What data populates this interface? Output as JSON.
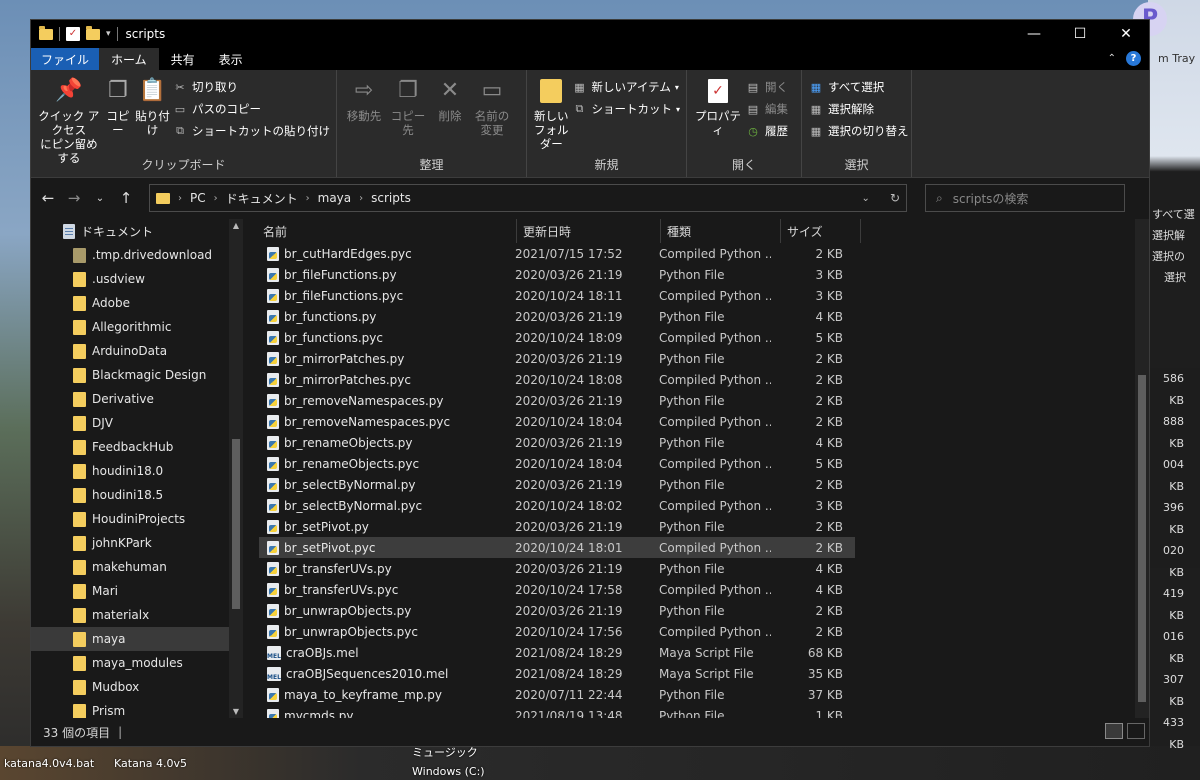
{
  "window": {
    "title": "scripts",
    "controls": [
      "minimize-icon",
      "maximize-icon",
      "close-icon"
    ]
  },
  "ribbon_tabs": [
    "ファイル",
    "ホーム",
    "共有",
    "表示"
  ],
  "ribbon": {
    "clipboard": {
      "label": "クリップボード",
      "pin": "クイック アクセス\nにピン留めする",
      "copy": "コピー",
      "paste": "貼り付け",
      "cut": "切り取り",
      "copy_path": "パスのコピー",
      "paste_shortcut": "ショートカットの貼り付け"
    },
    "organize": {
      "label": "整理",
      "move_to": "移動先",
      "copy_to": "コピー先",
      "delete": "削除",
      "rename": "名前の\n変更"
    },
    "new": {
      "label": "新規",
      "new_folder": "新しい\nフォルダー",
      "new_item": "新しいアイテム",
      "shortcut": "ショートカット"
    },
    "open": {
      "label": "開く",
      "properties": "プロパティ",
      "open": "開く",
      "edit": "編集",
      "history": "履歴"
    },
    "select": {
      "label": "選択",
      "select_all": "すべて選択",
      "select_none": "選択解除",
      "invert": "選択の切り替え"
    }
  },
  "address": {
    "crumbs": [
      "PC",
      "ドキュメント",
      "maya",
      "scripts"
    ],
    "search_placeholder": "scriptsの検索"
  },
  "nav": {
    "root": "ドキュメント",
    "items": [
      ".tmp.drivedownload",
      ".usdview",
      "Adobe",
      "Allegorithmic",
      "ArduinoData",
      "Blackmagic Design",
      "Derivative",
      "DJV",
      "FeedbackHub",
      "houdini18.0",
      "houdini18.5",
      "HoudiniProjects",
      "johnKPark",
      "makehuman",
      "Mari",
      "materialx",
      "maya",
      "maya_modules",
      "Mudbox",
      "Prism"
    ],
    "selected": "maya"
  },
  "columns": [
    "名前",
    "更新日時",
    "種類",
    "サイズ"
  ],
  "files": [
    {
      "name": "br_cutHardEdges.pyc",
      "date": "2021/07/15 17:52",
      "type": "Compiled Python ...",
      "size": "2 KB",
      "icon": "pyc"
    },
    {
      "name": "br_fileFunctions.py",
      "date": "2020/03/26 21:19",
      "type": "Python File",
      "size": "3 KB",
      "icon": "py"
    },
    {
      "name": "br_fileFunctions.pyc",
      "date": "2020/10/24 18:11",
      "type": "Compiled Python ...",
      "size": "3 KB",
      "icon": "pyc"
    },
    {
      "name": "br_functions.py",
      "date": "2020/03/26 21:19",
      "type": "Python File",
      "size": "4 KB",
      "icon": "py"
    },
    {
      "name": "br_functions.pyc",
      "date": "2020/10/24 18:09",
      "type": "Compiled Python ...",
      "size": "5 KB",
      "icon": "pyc"
    },
    {
      "name": "br_mirrorPatches.py",
      "date": "2020/03/26 21:19",
      "type": "Python File",
      "size": "2 KB",
      "icon": "py"
    },
    {
      "name": "br_mirrorPatches.pyc",
      "date": "2020/10/24 18:08",
      "type": "Compiled Python ...",
      "size": "2 KB",
      "icon": "pyc"
    },
    {
      "name": "br_removeNamespaces.py",
      "date": "2020/03/26 21:19",
      "type": "Python File",
      "size": "2 KB",
      "icon": "py"
    },
    {
      "name": "br_removeNamespaces.pyc",
      "date": "2020/10/24 18:04",
      "type": "Compiled Python ...",
      "size": "2 KB",
      "icon": "pyc"
    },
    {
      "name": "br_renameObjects.py",
      "date": "2020/03/26 21:19",
      "type": "Python File",
      "size": "4 KB",
      "icon": "py"
    },
    {
      "name": "br_renameObjects.pyc",
      "date": "2020/10/24 18:04",
      "type": "Compiled Python ...",
      "size": "5 KB",
      "icon": "pyc"
    },
    {
      "name": "br_selectByNormal.py",
      "date": "2020/03/26 21:19",
      "type": "Python File",
      "size": "2 KB",
      "icon": "py"
    },
    {
      "name": "br_selectByNormal.pyc",
      "date": "2020/10/24 18:02",
      "type": "Compiled Python ...",
      "size": "3 KB",
      "icon": "pyc"
    },
    {
      "name": "br_setPivot.py",
      "date": "2020/03/26 21:19",
      "type": "Python File",
      "size": "2 KB",
      "icon": "py"
    },
    {
      "name": "br_setPivot.pyc",
      "date": "2020/10/24 18:01",
      "type": "Compiled Python ...",
      "size": "2 KB",
      "icon": "pyc",
      "selected": true
    },
    {
      "name": "br_transferUVs.py",
      "date": "2020/03/26 21:19",
      "type": "Python File",
      "size": "4 KB",
      "icon": "py"
    },
    {
      "name": "br_transferUVs.pyc",
      "date": "2020/10/24 17:58",
      "type": "Compiled Python ...",
      "size": "4 KB",
      "icon": "pyc"
    },
    {
      "name": "br_unwrapObjects.py",
      "date": "2020/03/26 21:19",
      "type": "Python File",
      "size": "2 KB",
      "icon": "py"
    },
    {
      "name": "br_unwrapObjects.pyc",
      "date": "2020/10/24 17:56",
      "type": "Compiled Python ...",
      "size": "2 KB",
      "icon": "pyc"
    },
    {
      "name": "craOBJs.mel",
      "date": "2021/08/24 18:29",
      "type": "Maya Script File",
      "size": "68 KB",
      "icon": "mel"
    },
    {
      "name": "craOBJSequences2010.mel",
      "date": "2021/08/24 18:29",
      "type": "Maya Script File",
      "size": "35 KB",
      "icon": "mel"
    },
    {
      "name": "maya_to_keyframe_mp.py",
      "date": "2020/07/11 22:44",
      "type": "Python File",
      "size": "37 KB",
      "icon": "py"
    },
    {
      "name": "mycmds.py",
      "date": "2021/08/19 13:48",
      "type": "Python File",
      "size": "1 KB",
      "icon": "py"
    }
  ],
  "status": {
    "count": "33 個の項目"
  },
  "desktop": {
    "bottom_left_1": "katana4.0v4.bat",
    "bottom_left_2": "Katana 4.0v5",
    "bottom_mid_1": "ミュージック",
    "bottom_mid_2": "Windows (C:)",
    "right_label": "m Tray",
    "bg_sizes": [
      "586 KB",
      "888 KB",
      "004 KB",
      "396 KB",
      "020 KB",
      "419 KB",
      "016 KB",
      "307 KB",
      "433 KB"
    ],
    "bg_menu": [
      "すべて選",
      "選択解",
      "選択の",
      "選択"
    ]
  }
}
